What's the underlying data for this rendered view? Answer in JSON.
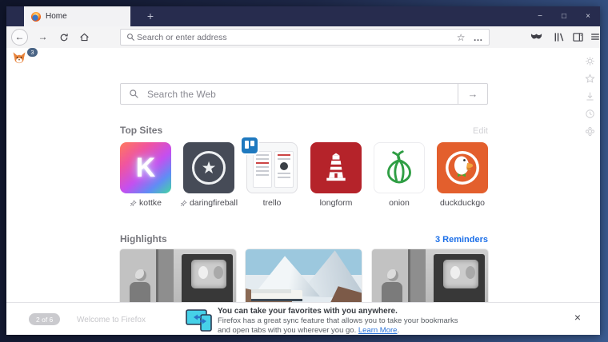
{
  "window_controls": {
    "minimize": "−",
    "maximize": "□",
    "close": "×"
  },
  "titlebar": {
    "tab_title": "Home",
    "new_tab": "+"
  },
  "toolbar": {
    "back": "←",
    "forward": "→",
    "url_placeholder": "Search or enter address",
    "bookmark_star": "☆",
    "page_actions": "…"
  },
  "content": {
    "fox_badge": "3",
    "search_placeholder": "Search the Web",
    "search_submit": "→",
    "top_sites": {
      "title": "Top Sites",
      "edit": "Edit",
      "sites": [
        {
          "label": "kottke",
          "tile_letter": "K",
          "pinned": true
        },
        {
          "label": "daringfireball",
          "tile_glyph": "★",
          "pinned": true
        },
        {
          "label": "trello",
          "pinned": false
        },
        {
          "label": "longform",
          "pinned": false
        },
        {
          "label": "onion",
          "pinned": false
        },
        {
          "label": "duckduckgo",
          "pinned": false
        }
      ]
    },
    "highlights": {
      "title": "Highlights",
      "reminders": "3 Reminders"
    },
    "onboarding": {
      "step": "2 of 6",
      "welcome": "Welcome to Firefox"
    },
    "notification": {
      "title": "You can take your favorites with you anywhere.",
      "body1": "Firefox has a great sync feature that allows you to take your bookmarks",
      "body2": "and open tabs with you wherever you go.",
      "link": "Learn More",
      "suffix": ".",
      "close": "×"
    }
  },
  "colors": {
    "titlebar": "#272c4e",
    "toolbar_bg": "#f4f4f5",
    "accent_blue": "#1c6fe8",
    "desktop_gradient_start": "#10152a",
    "desktop_gradient_end": "#3b5c92",
    "longform_red": "#b5232a",
    "duckduckgo_orange": "#e35f2d",
    "trello_blue": "#1f79bf",
    "onion_green": "#2f9e44"
  }
}
